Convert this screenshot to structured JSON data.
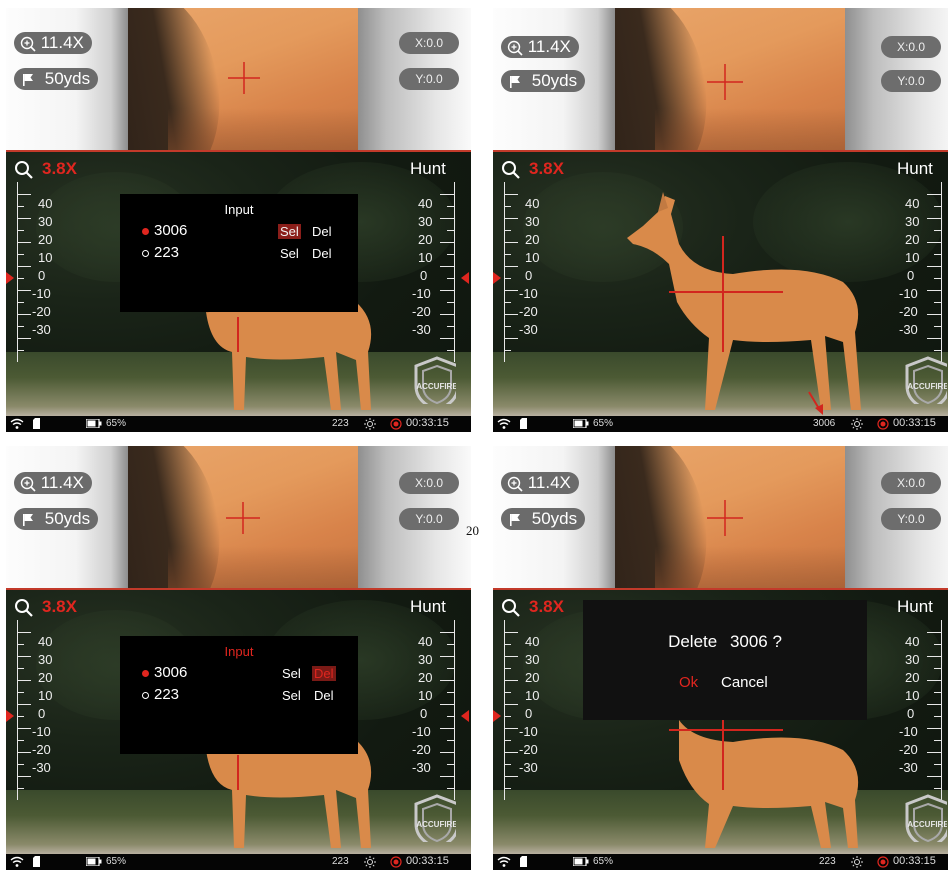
{
  "panels": [
    {
      "zoom": "11.4X",
      "distance": "50yds",
      "x": "X:0.0",
      "y": "Y:0.0",
      "mag": "3.8X",
      "mode": "Hunt",
      "scale_left": [
        "40",
        "30",
        "20",
        "10",
        "0",
        "-10",
        "-20",
        "-30"
      ],
      "scale_right": [
        "40",
        "30",
        "20",
        "10",
        "0",
        "-10",
        "-20",
        "-30"
      ],
      "battery": "65%",
      "profile": "223",
      "time": "00:33:15",
      "dialog": {
        "title": "Input",
        "items": [
          {
            "name": "3006",
            "sel": "Sel",
            "del": "Del"
          },
          {
            "name": "223",
            "sel": "Sel",
            "del": "Del"
          }
        ]
      }
    },
    {
      "zoom": "11.4X",
      "distance": "50yds",
      "x": "X:0.0",
      "y": "Y:0.0",
      "mag": "3.8X",
      "mode": "Hunt",
      "scale_left": [
        "40",
        "30",
        "20",
        "10",
        "0",
        "-10",
        "-20",
        "-30"
      ],
      "scale_right": [
        "40",
        "30",
        "20",
        "10",
        "0",
        "-10",
        "-20",
        "-30"
      ],
      "battery": "65%",
      "profile": "3006",
      "time": "00:33:15"
    },
    {
      "zoom": "11.4X",
      "distance": "50yds",
      "x": "X:0.0",
      "y": "Y:0.0",
      "mag": "3.8X",
      "mode": "Hunt",
      "scale_left": [
        "40",
        "30",
        "20",
        "10",
        "0",
        "-10",
        "-20",
        "-30"
      ],
      "scale_right": [
        "40",
        "30",
        "20",
        "10",
        "0",
        "-10",
        "-20",
        "-30"
      ],
      "battery": "65%",
      "profile": "223",
      "time": "00:33:15",
      "dialog": {
        "title": "Input",
        "items": [
          {
            "name": "3006",
            "sel": "Sel",
            "del": "Del"
          },
          {
            "name": "223",
            "sel": "Sel",
            "del": "Del"
          }
        ]
      }
    },
    {
      "zoom": "11.4X",
      "distance": "50yds",
      "x": "X:0.0",
      "y": "Y:0.0",
      "mag": "3.8X",
      "mode": "Hunt",
      "scale_left": [
        "40",
        "30",
        "20",
        "10",
        "0",
        "-10",
        "-20",
        "-30"
      ],
      "scale_right": [
        "40",
        "30",
        "20",
        "10",
        "0",
        "-10",
        "-20",
        "-30"
      ],
      "battery": "65%",
      "profile": "223",
      "time": "00:33:15",
      "confirm": {
        "label": "Delete",
        "target": "3006 ?",
        "ok": "Ok",
        "cancel": "Cancel"
      }
    }
  ],
  "page_number": "20",
  "logo_text": "ACCUFIRE",
  "colors": {
    "accent_red": "#e0261f",
    "pill_gray": "#6b6b6b"
  },
  "icons": [
    "zoom-in-icon",
    "flag-icon",
    "search-icon",
    "wifi-icon",
    "sd-card-icon",
    "battery-icon",
    "brightness-icon",
    "record-icon"
  ]
}
